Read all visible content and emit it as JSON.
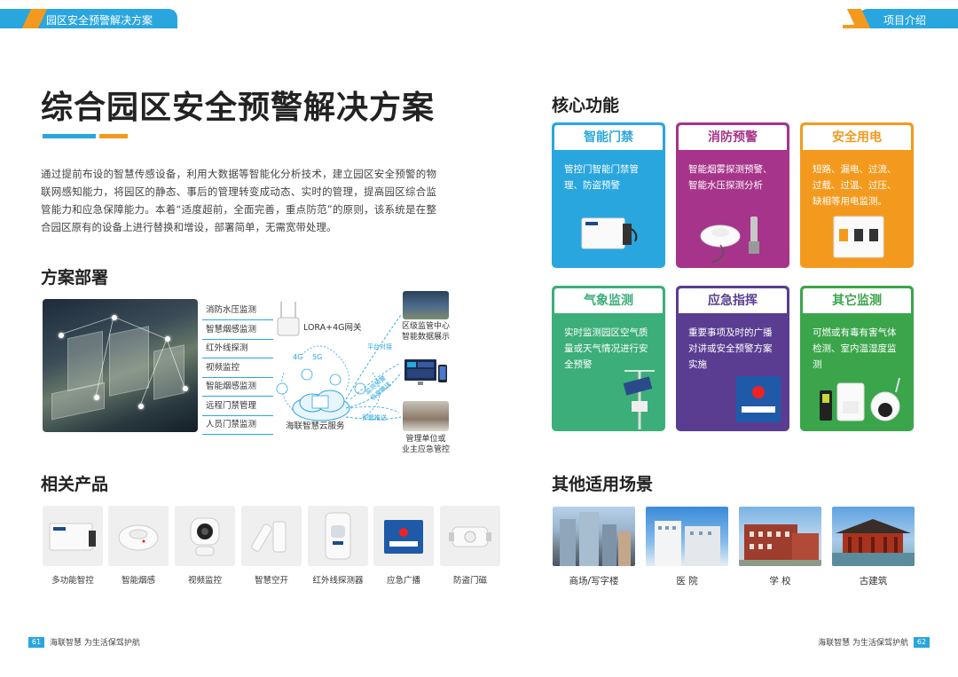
{
  "header": {
    "left_tab": "园区安全预警解决方案",
    "right_tab": "项目介绍"
  },
  "left": {
    "title": "综合园区安全预警解决方案",
    "intro": "通过提前布设的智慧传感设备，利用大数据等智能化分析技术，建立园区安全预警的物联网感知能力，将园区的静态、事后的管理转变成动态、实时的管理，提高园区综合监管能力和应急保障能力。本着“适度超前，全面完善，重点防范”的原则，该系统是在整合园区原有的设备上进行替换和增设，部署简单，无需宽带处理。",
    "deploy_heading": "方案部署",
    "deploy_labels": [
      "消防水压监测",
      "智慧烟感监测",
      "红外线探测",
      "视频监控",
      "智能烟感监测",
      "远程门禁管理",
      "人员门禁监测"
    ],
    "lora_label": "LORA+4G网关",
    "net_4g": "4G",
    "net_5g": "5G",
    "cloud_label": "海联智慧云服务",
    "center_caption": [
      "区级监管中心",
      "智能数据展示"
    ],
    "person_caption": [
      "管理单位或",
      "业主应急管控"
    ],
    "link_labels": [
      "平台对接",
      "监测预警信息推送",
      "预警推送"
    ],
    "products_heading": "相关产品",
    "products": [
      "多功能智控",
      "智能烟感",
      "视频监控",
      "智慧空开",
      "红外线探测器",
      "应急广播",
      "防盗门磁"
    ]
  },
  "right": {
    "core_heading": "核心功能",
    "cards": [
      {
        "title": "智能门禁",
        "text": "管控门智能门禁管理、防盗预警",
        "color": "#2aa6de"
      },
      {
        "title": "消防预警",
        "text": "智能烟雾探测预警、智能水压探测分析",
        "color": "#a6348a"
      },
      {
        "title": "安全用电",
        "text": "短路、漏电、过流、过载、过温、过压、缺相等用电监测。",
        "color": "#f39a1e"
      },
      {
        "title": "气象监测",
        "text": "实时监测园区空气质量或天气情况进行安全预警",
        "color": "#3cae7a"
      },
      {
        "title": "应急指挥",
        "text": "重要事项及时的广播对讲或安全预警方案实施",
        "color": "#5a3d91"
      },
      {
        "title": "其它监测",
        "text": "可燃或有毒有害气体检测、室内温湿度监测",
        "color": "#3aa54a"
      }
    ],
    "scenes_heading": "其他适用场景",
    "scenes": [
      "商场/写字楼",
      "医 院",
      "学 校",
      "古建筑"
    ]
  },
  "footer": {
    "left_num": "61",
    "left_text": "海联智慧  为生活保驾护航",
    "right_num": "62",
    "right_text": "海联智慧  为生活保驾护航"
  }
}
